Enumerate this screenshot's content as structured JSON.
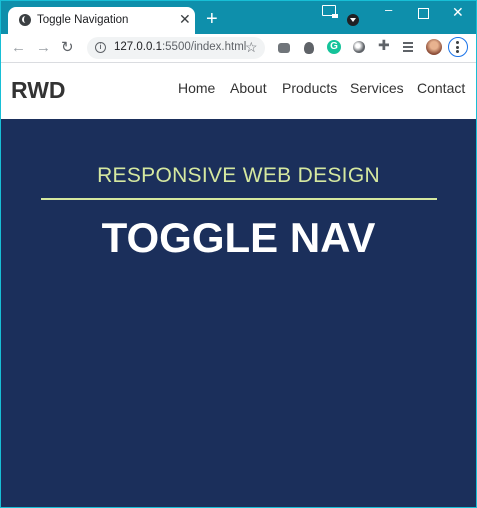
{
  "browser": {
    "tab_title": "Toggle Navigation",
    "url_host": "127.0.0.1",
    "url_path": ":5500/index.html",
    "new_tab_glyph": "+",
    "close_glyph": "✕"
  },
  "site": {
    "logo": "RWD",
    "nav": [
      "Home",
      "About",
      "Products",
      "Services",
      "Contact"
    ]
  },
  "hero": {
    "subtitle": "RESPONSIVE WEB DESIGN",
    "title": "TOGGLE NAV"
  },
  "colors": {
    "hero_bg": "#1b2f5b",
    "accent": "#d5e8a0",
    "browser_frame": "#0e8fab"
  },
  "icons": [
    "globe-icon",
    "close-icon",
    "plus-icon",
    "back-icon",
    "forward-icon",
    "reload-icon",
    "info-icon",
    "star-icon",
    "camera-icon",
    "bug-icon",
    "grammarly-icon",
    "extension-icon",
    "puzzle-icon",
    "media-icon",
    "menu-icon"
  ]
}
